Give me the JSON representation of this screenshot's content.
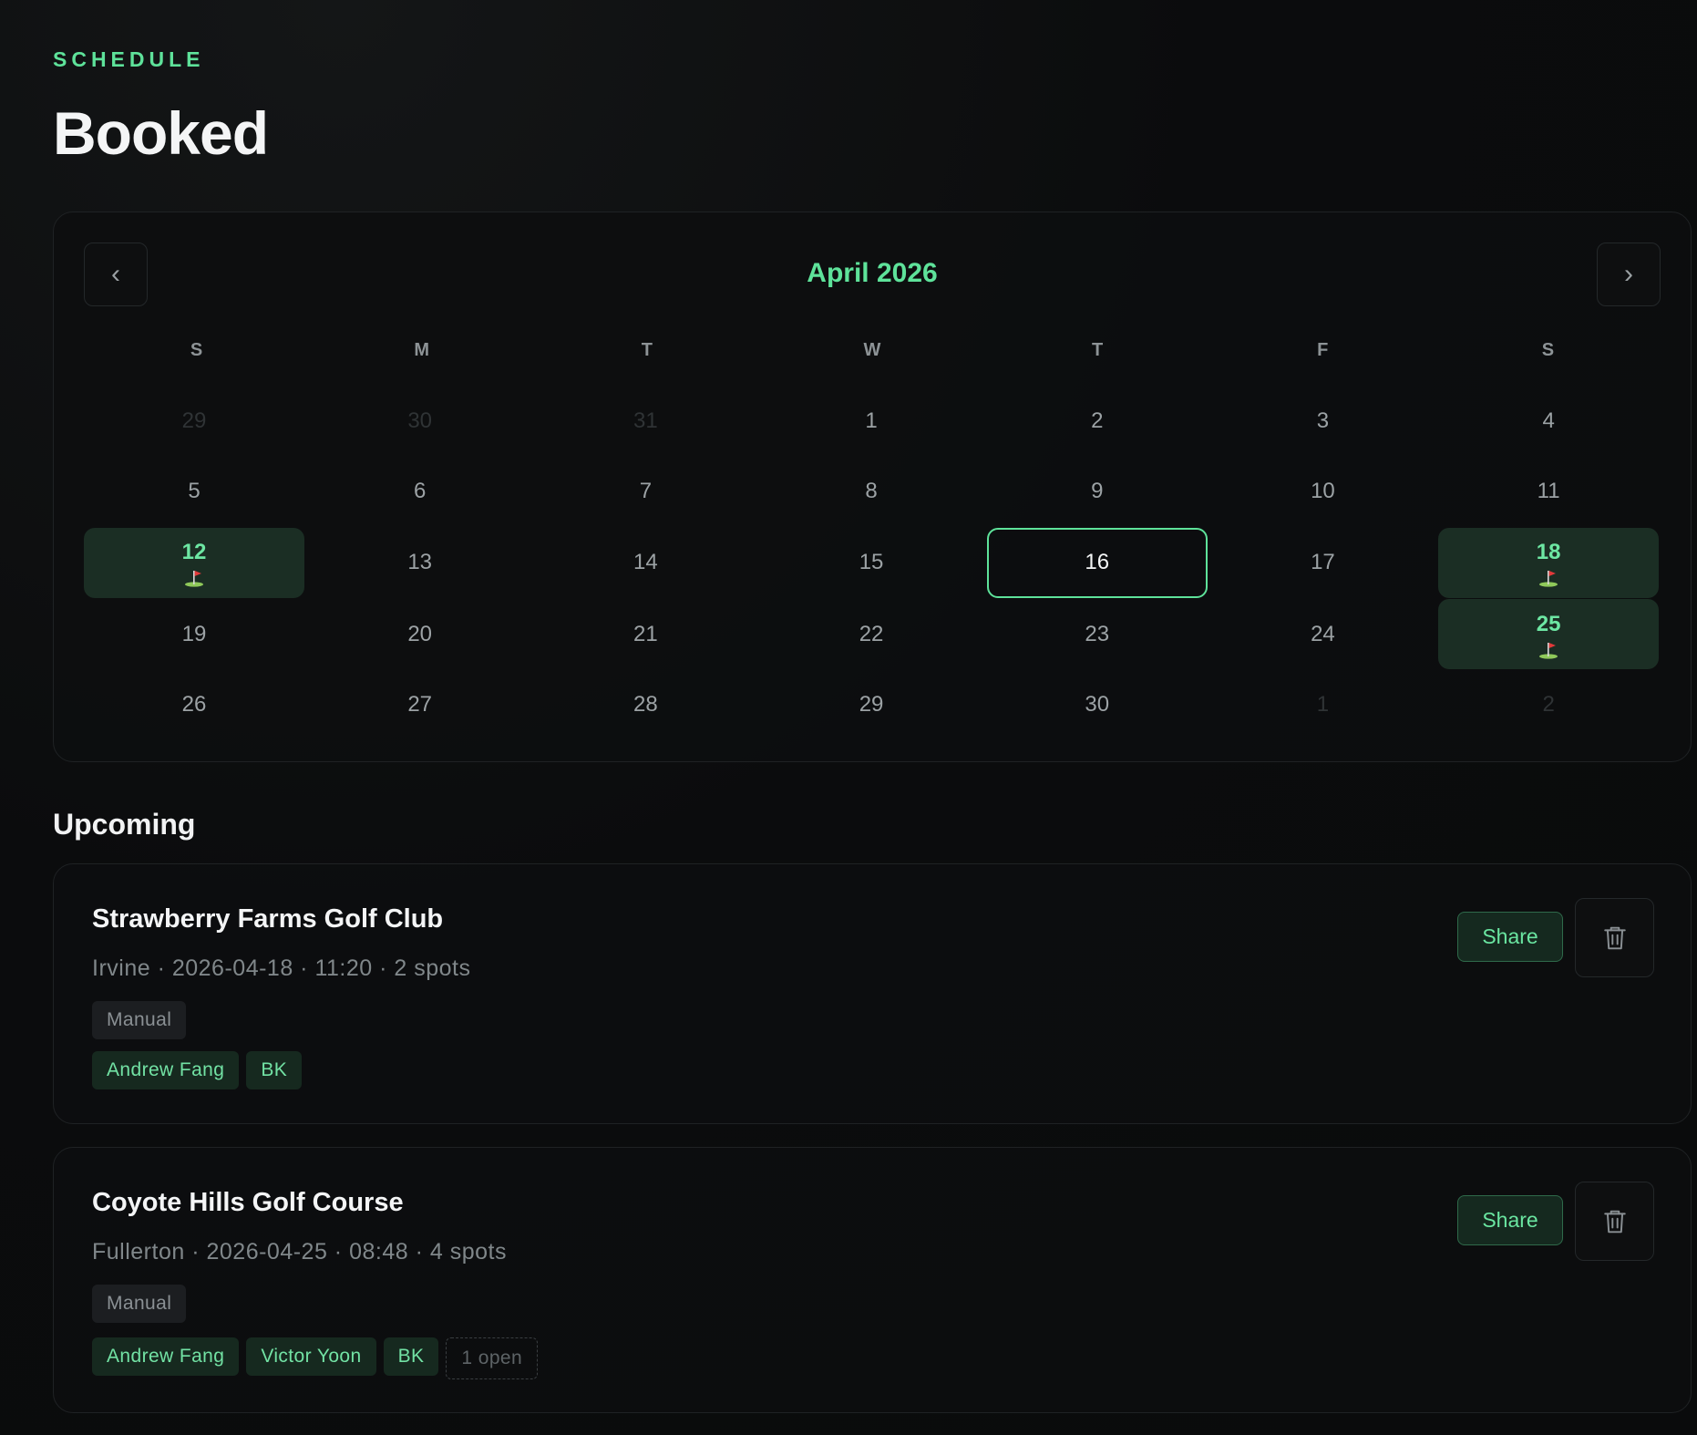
{
  "header": {
    "eyebrow": "SCHEDULE",
    "title": "Booked"
  },
  "calendar": {
    "month_label": "April 2026",
    "prev_label": "‹",
    "next_label": "›",
    "weekdays": [
      "S",
      "M",
      "T",
      "W",
      "T",
      "F",
      "S"
    ],
    "weeks": [
      [
        {
          "label": "29",
          "state": "muted"
        },
        {
          "label": "30",
          "state": "muted"
        },
        {
          "label": "31",
          "state": "muted"
        },
        {
          "label": "1",
          "state": "normal"
        },
        {
          "label": "2",
          "state": "normal"
        },
        {
          "label": "3",
          "state": "normal"
        },
        {
          "label": "4",
          "state": "normal"
        }
      ],
      [
        {
          "label": "5",
          "state": "normal"
        },
        {
          "label": "6",
          "state": "normal"
        },
        {
          "label": "7",
          "state": "normal"
        },
        {
          "label": "8",
          "state": "normal"
        },
        {
          "label": "9",
          "state": "normal"
        },
        {
          "label": "10",
          "state": "normal"
        },
        {
          "label": "11",
          "state": "normal"
        }
      ],
      [
        {
          "label": "12",
          "state": "booked"
        },
        {
          "label": "13",
          "state": "normal"
        },
        {
          "label": "14",
          "state": "normal"
        },
        {
          "label": "15",
          "state": "normal"
        },
        {
          "label": "16",
          "state": "today"
        },
        {
          "label": "17",
          "state": "normal"
        },
        {
          "label": "18",
          "state": "booked"
        }
      ],
      [
        {
          "label": "19",
          "state": "normal"
        },
        {
          "label": "20",
          "state": "normal"
        },
        {
          "label": "21",
          "state": "normal"
        },
        {
          "label": "22",
          "state": "normal"
        },
        {
          "label": "23",
          "state": "normal"
        },
        {
          "label": "24",
          "state": "normal"
        },
        {
          "label": "25",
          "state": "booked"
        }
      ],
      [
        {
          "label": "26",
          "state": "normal"
        },
        {
          "label": "27",
          "state": "normal"
        },
        {
          "label": "28",
          "state": "normal"
        },
        {
          "label": "29",
          "state": "normal"
        },
        {
          "label": "30",
          "state": "normal"
        },
        {
          "label": "1",
          "state": "muted"
        },
        {
          "label": "2",
          "state": "muted"
        }
      ]
    ],
    "booked_icon": "golf-flag-icon"
  },
  "upcoming": {
    "title": "Upcoming",
    "bookings": [
      {
        "course": "Strawberry Farms Golf Club",
        "meta": "Irvine · 2026-04-18 · 11:20 · 2 spots",
        "source": "Manual",
        "players": [
          "Andrew Fang",
          "BK"
        ],
        "open": "",
        "share_label": "Share",
        "delete_icon": "trash-icon"
      },
      {
        "course": "Coyote Hills Golf Course",
        "meta": "Fullerton · 2026-04-25 · 08:48 · 4 spots",
        "source": "Manual",
        "players": [
          "Andrew Fang",
          "Victor Yoon",
          "BK"
        ],
        "open": "1 open",
        "share_label": "Share",
        "delete_icon": "trash-icon"
      }
    ]
  },
  "colors": {
    "accent": "#5ee29a",
    "background": "#0a0b0c",
    "card": "#0d0e0f",
    "booked_bg": "#1b2e24"
  }
}
